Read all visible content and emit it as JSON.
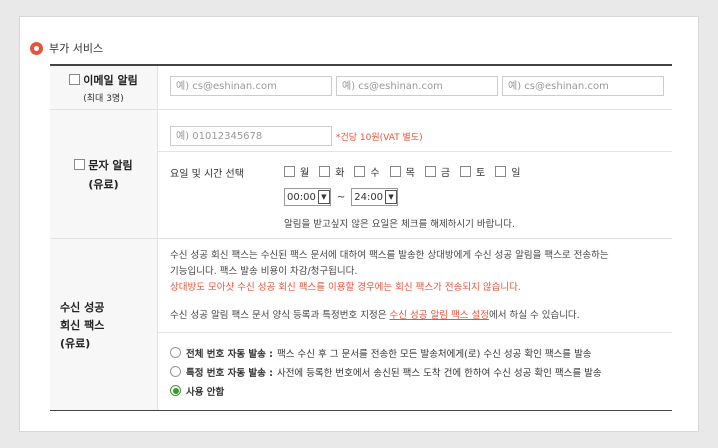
{
  "section_title": "부가 서비스",
  "email": {
    "label": "이메일 알림",
    "sub": "(최대 3명)",
    "placeholders": [
      "예) cs@eshinan.com",
      "예) cs@eshinan.com",
      "예) cs@eshinan.com"
    ]
  },
  "sms": {
    "label": "문자 알림",
    "sub": "(유료)",
    "phone_placeholder": "예) 01012345678",
    "price_note": "*건당 10원(VAT 별도)",
    "schedule_label": "요일 및 시간 선택",
    "days": [
      "월",
      "화",
      "수",
      "목",
      "금",
      "토",
      "일"
    ],
    "start_time": "00:00",
    "end_time": "24:00",
    "tilde": "~",
    "hint": "알림을 받고싶지 않은 요일은 체크를 해제하시기 바랍니다."
  },
  "fax": {
    "label_line1": "수신 성공",
    "label_line2": "회신 팩스",
    "label_line3": "(유료)",
    "desc_line1": "수신 성공 회신 팩스는 수신된 팩스 문서에 대하여 팩스를 발송한 상대방에게 수신 성공 알림을 팩스로 전송하는",
    "desc_line2": "기능입니다. 팩스 발송 비용이 차감/청구됩니다.",
    "desc_warning": "상대방도 모아샷 수신 성공 회신 팩스를 이용할 경우에는 회신 팩스가 전송되지 않습니다.",
    "desc_reg_pre": "수신 성공 알림 팩스 문서 양식 등록과 특정번호 지정은 ",
    "desc_reg_link": "수신 성공 알림 팩스 설정",
    "desc_reg_post": "에서 하실 수 있습니다.",
    "options": [
      {
        "title": "전체 번호 자동 발송 :",
        "desc": "팩스 수신 후 그 문서를 전송한 모든 발송처에게(로) 수신 성공 확인 팩스를 발송",
        "selected": false
      },
      {
        "title": "특정 번호 자동 발송 :",
        "desc": "사전에 등록한 번호에서 송신된 팩스 도착 건에 한하여 수신 성공 확인 팩스를 발송",
        "selected": false
      },
      {
        "title": "사용 안함",
        "desc": "",
        "selected": true
      }
    ]
  },
  "colors": {
    "accent": "#e8543a",
    "radio_on": "#3a9b2c"
  }
}
